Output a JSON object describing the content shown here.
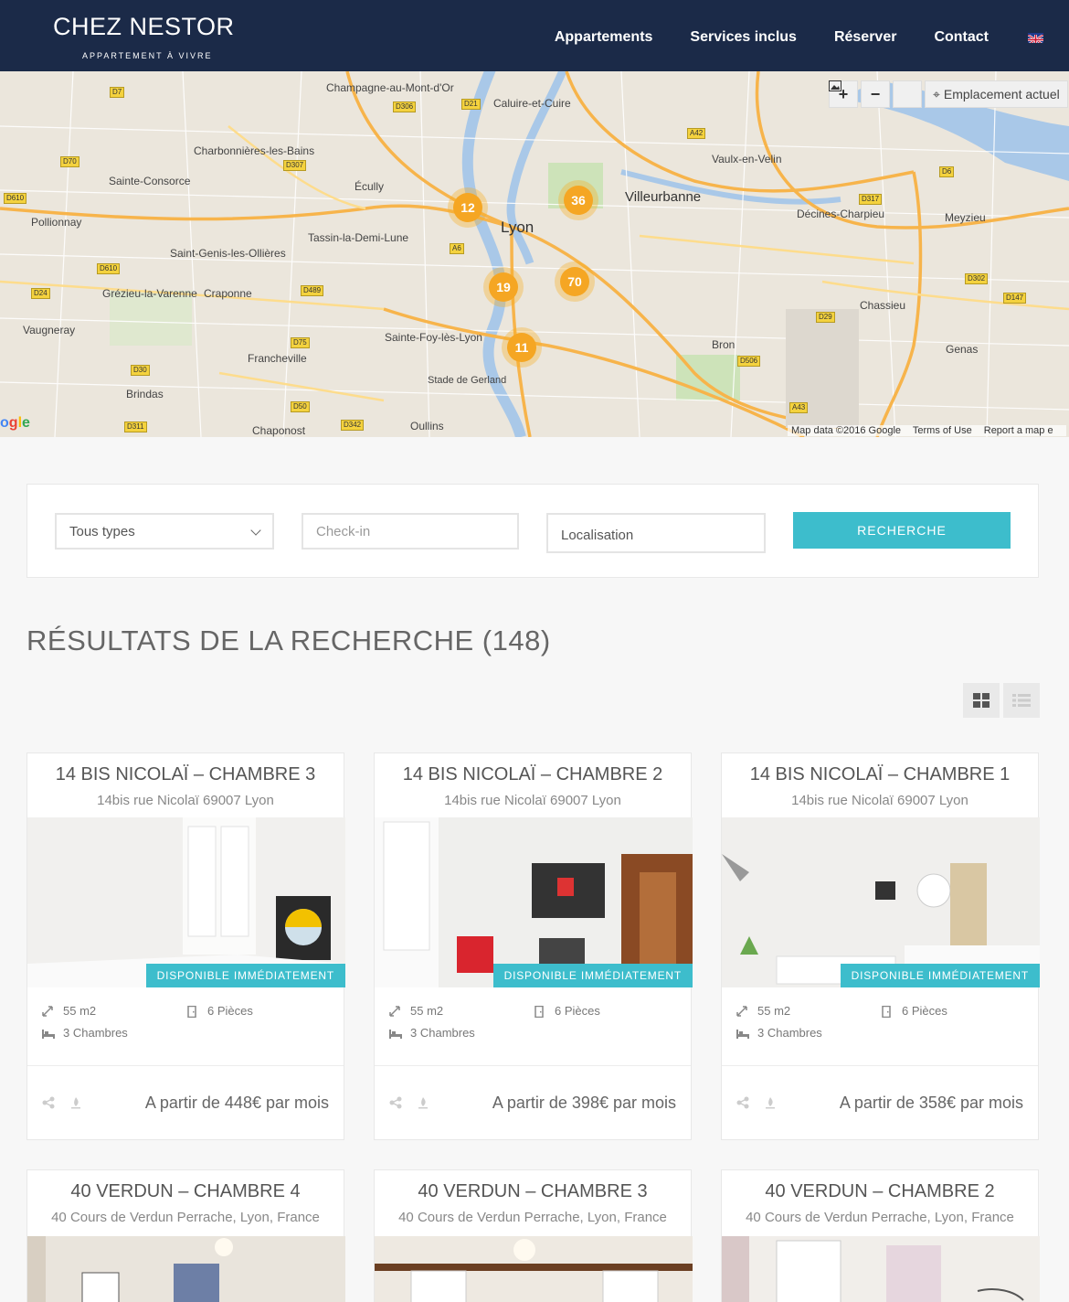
{
  "brand": {
    "name": "CHEZ NESTOR",
    "tagline": "APPARTEMENT À VIVRE"
  },
  "nav": {
    "items": [
      "Appartements",
      "Services inclus",
      "Réserver",
      "Contact"
    ],
    "lang": "en-flag"
  },
  "map": {
    "controls": {
      "zoom_in": "+",
      "zoom_out": "−",
      "location": "Emplacement actuel"
    },
    "attribution": [
      "Map data ©2016 Google",
      "Terms of Use",
      "Report a map e"
    ],
    "google": "Google",
    "places": [
      "Champagne-au-Mont-d'Or",
      "Caluire-et-Cuire",
      "Vaulx-en-Velin",
      "Charbonnières-les-Bains",
      "Sainte-Consorce",
      "Écully",
      "Villeurbanne",
      "Pollionnay",
      "Tassin-la-Demi-Lune",
      "Lyon",
      "Décines-Charpieu",
      "Meyzieu",
      "Saint-Genis-les-Ollières",
      "Grézieu-la-Varenne",
      "Craponne",
      "Chassieu",
      "Vaugneray",
      "Sainte-Foy-lès-Lyon",
      "Francheville",
      "Bron",
      "Genas",
      "Brindas",
      "Stade de Gerland",
      "Chaponost",
      "Oullins"
    ],
    "clusters": [
      {
        "count": "12"
      },
      {
        "count": "36"
      },
      {
        "count": "19"
      },
      {
        "count": "70"
      },
      {
        "count": "11"
      }
    ]
  },
  "search": {
    "type_value": "Tous types",
    "checkin_placeholder": "Check-in",
    "location_placeholder": "Localisation",
    "button": "RECHERCHE"
  },
  "results": {
    "title": "RÉSULTATS DE LA RECHERCHE (148)"
  },
  "listings": [
    {
      "title": "14 BIS NICOLAÏ – CHAMBRE 3",
      "address": "14bis rue Nicolaï 69007 Lyon",
      "badge": "DISPONIBLE IMMÉDIATEMENT",
      "area": "55 m2",
      "rooms": "6 Pièces",
      "bedrooms": "3 Chambres",
      "price": "A partir de 448€  par mois"
    },
    {
      "title": "14 BIS NICOLAÏ – CHAMBRE 2",
      "address": "14bis rue Nicolaï 69007 Lyon",
      "badge": "DISPONIBLE IMMÉDIATEMENT",
      "area": "55 m2",
      "rooms": "6 Pièces",
      "bedrooms": "3 Chambres",
      "price": "A partir de 398€  par mois"
    },
    {
      "title": "14 BIS NICOLAÏ – CHAMBRE 1",
      "address": "14bis rue Nicolaï 69007 Lyon",
      "badge": "DISPONIBLE IMMÉDIATEMENT",
      "area": "55 m2",
      "rooms": "6 Pièces",
      "bedrooms": "3 Chambres",
      "price": "A partir de 358€  par mois"
    },
    {
      "title": "40 VERDUN – CHAMBRE 4",
      "address": "40 Cours de Verdun Perrache, Lyon, France"
    },
    {
      "title": "40 VERDUN – CHAMBRE 3",
      "address": "40 Cours de Verdun Perrache, Lyon, France"
    },
    {
      "title": "40 VERDUN – CHAMBRE 2",
      "address": "40 Cours de Verdun Perrache, Lyon, France"
    }
  ],
  "colors": {
    "header": "#1b2a48",
    "accent": "#3dbdcc",
    "cluster": "#f5a623"
  }
}
